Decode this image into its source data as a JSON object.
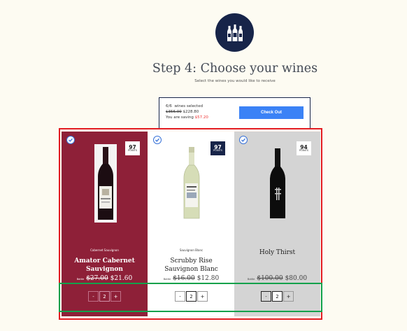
{
  "header": {
    "icon": "wine-bottles-icon",
    "title": "Step 4: Choose your wines",
    "subtitle": "Select the wines you would like to receive"
  },
  "summary": {
    "selected_count": "6/6",
    "selected_label": "wines selected",
    "original_total": "$356.00",
    "discounted_total": "$228.80",
    "saving_label": "You are saving",
    "saving_amount": "$57.20",
    "checkout_label": "Check Out"
  },
  "wines": [
    {
      "selected": true,
      "points": "97",
      "points_label": "POINTS",
      "varietal": "Cabernet Sauvignon",
      "name": "Amator Cabernet Sauvignon",
      "price_label": "Bottle",
      "old_price": "$27.00",
      "new_price": "$21.60",
      "quantity": "2",
      "minus": "-",
      "plus": "+",
      "card_color": "#8e2038"
    },
    {
      "selected": true,
      "points": "97",
      "points_label": "POINTS",
      "varietal": "Sauvignon Blanc",
      "name": "Scrubby Rise Sauvignon Blanc",
      "price_label": "Bottle",
      "old_price": "$16.00",
      "new_price": "$12.80",
      "quantity": "2",
      "minus": "-",
      "plus": "+",
      "card_color": "#ffffff"
    },
    {
      "selected": true,
      "points": "94",
      "points_label": "POINTS",
      "varietal": "",
      "name": "Holy Thirst",
      "price_label": "Bottle",
      "old_price": "$100.00",
      "new_price": "$80.00",
      "quantity": "2",
      "minus": "-",
      "plus": "+",
      "card_color": "#d4d4d4"
    }
  ],
  "colors": {
    "navy": "#172449",
    "checkout_blue": "#3b82f6",
    "saving_red": "#e33333",
    "highlight_red": "#e31d23",
    "highlight_green": "#12a14b"
  }
}
